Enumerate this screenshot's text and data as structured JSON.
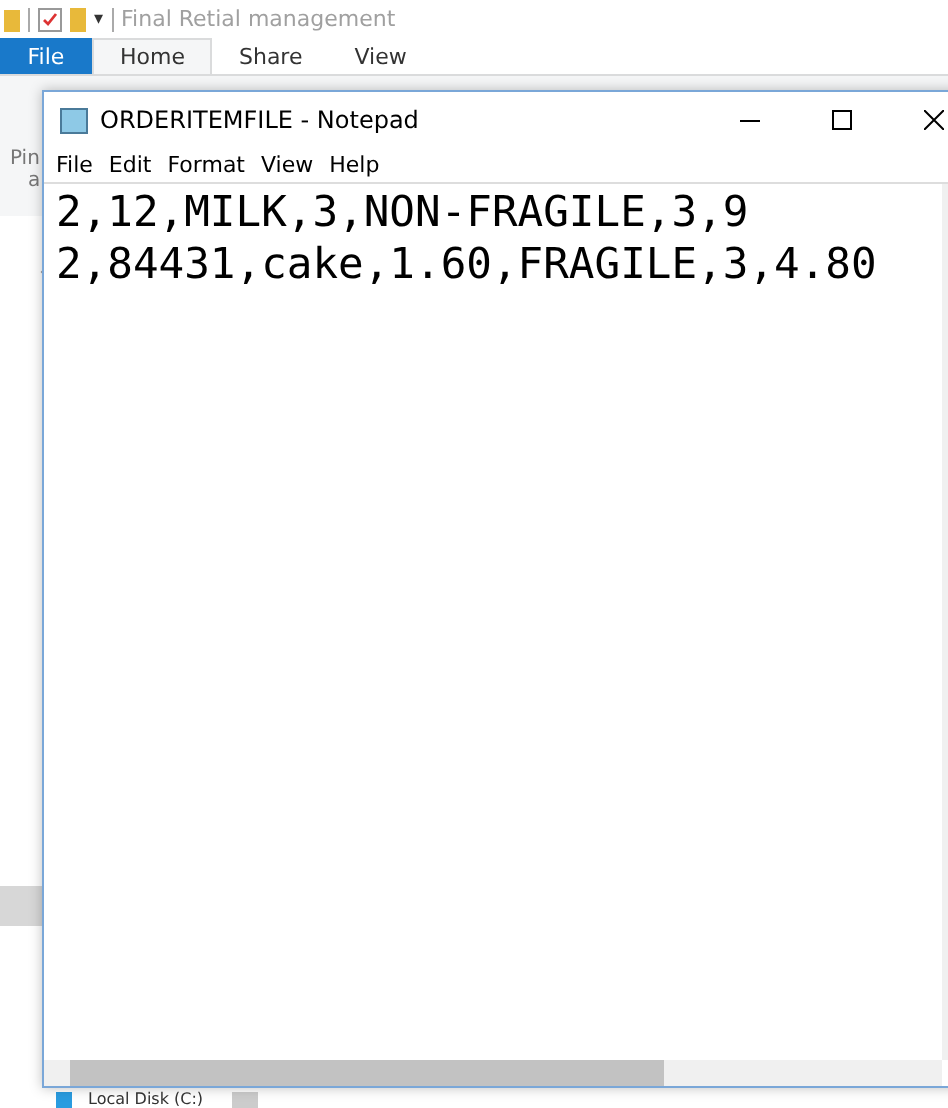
{
  "explorer": {
    "title": "Final Retial management",
    "qat_caret": "▾",
    "tabs": [
      {
        "label": "File",
        "kind": "file",
        "selected": false
      },
      {
        "label": "Home",
        "kind": "tab",
        "selected": true
      },
      {
        "label": "Share",
        "kind": "tab",
        "selected": false
      },
      {
        "label": "View",
        "kind": "tab",
        "selected": false
      }
    ],
    "ribbon_labels": [
      "Pin",
      "a"
    ],
    "nav_item": "Local Disk (C:)"
  },
  "notepad": {
    "title": "ORDERITEMFILE - Notepad",
    "menu": [
      "File",
      "Edit",
      "Format",
      "View",
      "Help"
    ],
    "lines": [
      "2,12,MILK,3,NON-FRAGILE,3,9",
      "2,84431,cake,1.60,FRAGILE,3,4.80"
    ]
  }
}
